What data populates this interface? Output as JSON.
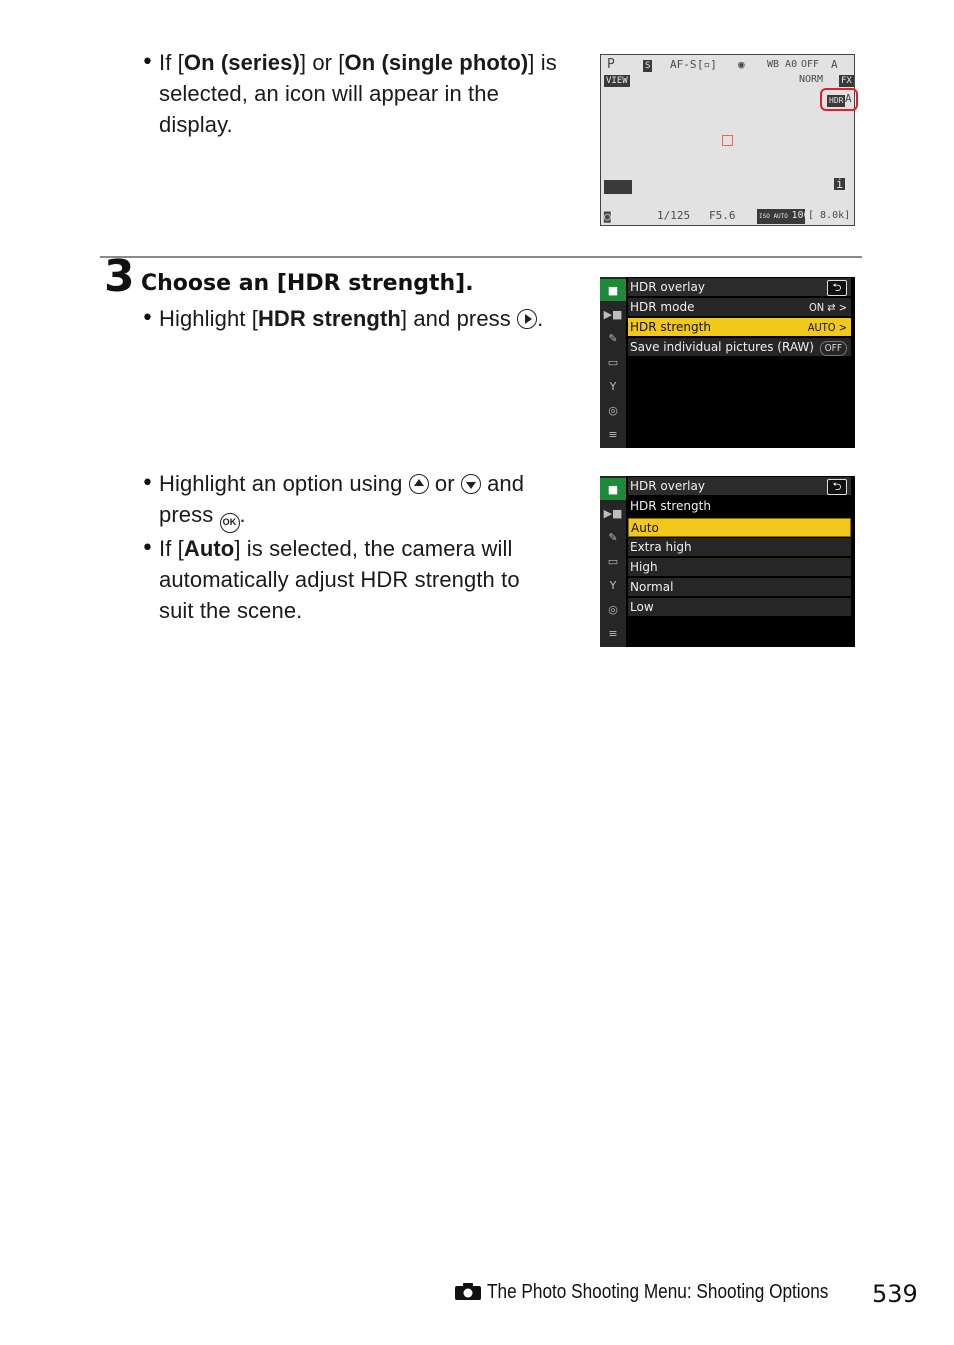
{
  "section1": {
    "bullet": "•",
    "parts": {
      "p1": "If [",
      "b1": "On (series)",
      "p2": "] or [",
      "b2": "On (single photo)",
      "p3": "] is",
      "line2": "selected, an icon will appear in the",
      "line3": "display."
    }
  },
  "liveview": {
    "mode": "P",
    "release": "S",
    "af_mode": "AF-S",
    "af_area": "[▫]",
    "vr": "◉",
    "wb": "WB A0",
    "adl": "OFF",
    "picture_control": "A",
    "view_mode": "VIEW",
    "quality": "NORM",
    "format": "FX",
    "hdr_indicator": "HDR",
    "hdr_value": "A",
    "shutter": "1/125",
    "aperture": "F5.6",
    "iso_label": "ISO AUTO",
    "iso_value": "100",
    "shots_remaining": "[ 8.0k]",
    "info_button": "i"
  },
  "step3": {
    "number": "3",
    "title": "Choose an [HDR strength].",
    "bullet1": {
      "p1": "Highlight [",
      "b1": "HDR strength",
      "p2": "] and press "
    },
    "bullet2": {
      "p1": "Highlight an option using ",
      "p2": " or ",
      "p3": " and",
      "line2": "press ",
      "ok": "OK"
    },
    "bullet3": {
      "p1": "If [",
      "b1": "Auto",
      "p2": "] is selected, the camera will",
      "line2": "automatically adjust HDR strength to",
      "line3": "suit the scene."
    }
  },
  "menu1": {
    "title": "HDR overlay",
    "back_icon": "⮌",
    "items": [
      {
        "label": "HDR mode",
        "value": "ON ⇄ >"
      },
      {
        "label": "HDR strength",
        "value": "AUTO >"
      },
      {
        "label": "Save individual pictures (RAW)",
        "value": "OFF"
      }
    ],
    "selected_index": 1
  },
  "menu2": {
    "title": "HDR overlay",
    "subtitle": "HDR strength",
    "options": [
      "Auto",
      "Extra high",
      "High",
      "Normal",
      "Low"
    ],
    "selected_index": 0
  },
  "rail_icons": [
    "camera",
    "movie",
    "pencil",
    "playback",
    "wrench",
    "network",
    "my-menu"
  ],
  "footer": {
    "section": "The Photo Shooting Menu: Shooting Options",
    "page": "539"
  },
  "colors": {
    "highlight": "#f2c81a",
    "active_tab": "#1d8a3a",
    "callout": "#e0202a"
  }
}
